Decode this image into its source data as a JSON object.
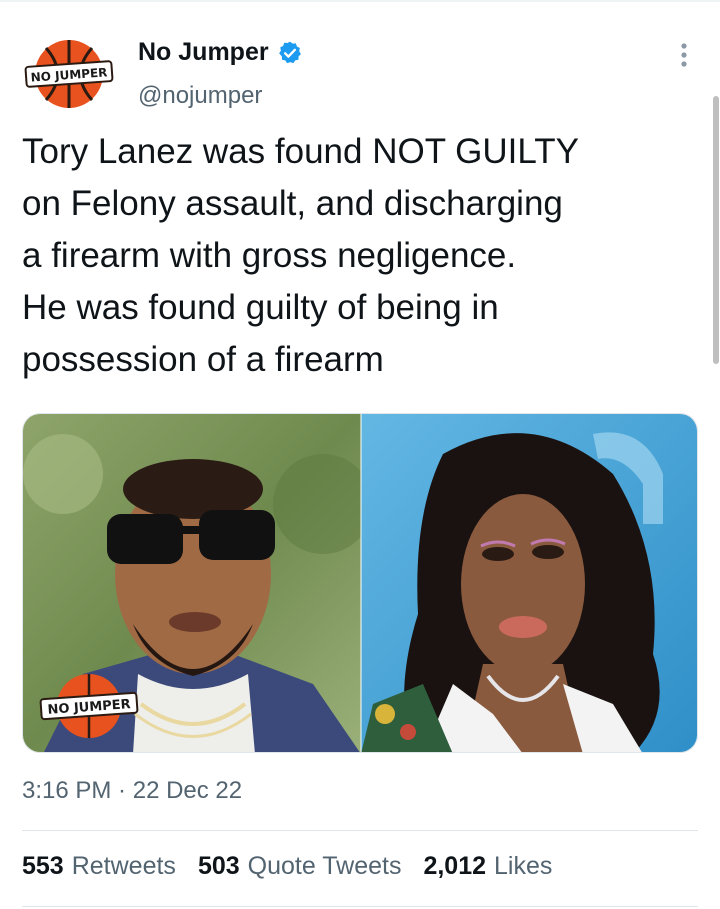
{
  "author": {
    "name": "No Jumper",
    "handle": "@nojumper",
    "logo_text": "NO JUMPER",
    "verified_color": "#1d9bf0"
  },
  "tweet": {
    "text_lines": [
      "Tory Lanez was found NOT GUILTY",
      "on Felony assault, and discharging",
      "a firearm with gross negligence.",
      "He was found guilty of being in",
      "possession of a firearm"
    ],
    "time": "3:16 PM",
    "separator": " · ",
    "date": "22 Dec 22",
    "media_watermark": "NO JUMPER"
  },
  "stats": {
    "retweets": {
      "count": "553",
      "label": "Retweets"
    },
    "quotes": {
      "count": "503",
      "label": "Quote Tweets"
    },
    "likes": {
      "count": "2,012",
      "label": "Likes"
    }
  },
  "colors": {
    "accent": "#1d9bf0",
    "secondary_text": "#536471",
    "logo_orange": "#e8521e"
  }
}
